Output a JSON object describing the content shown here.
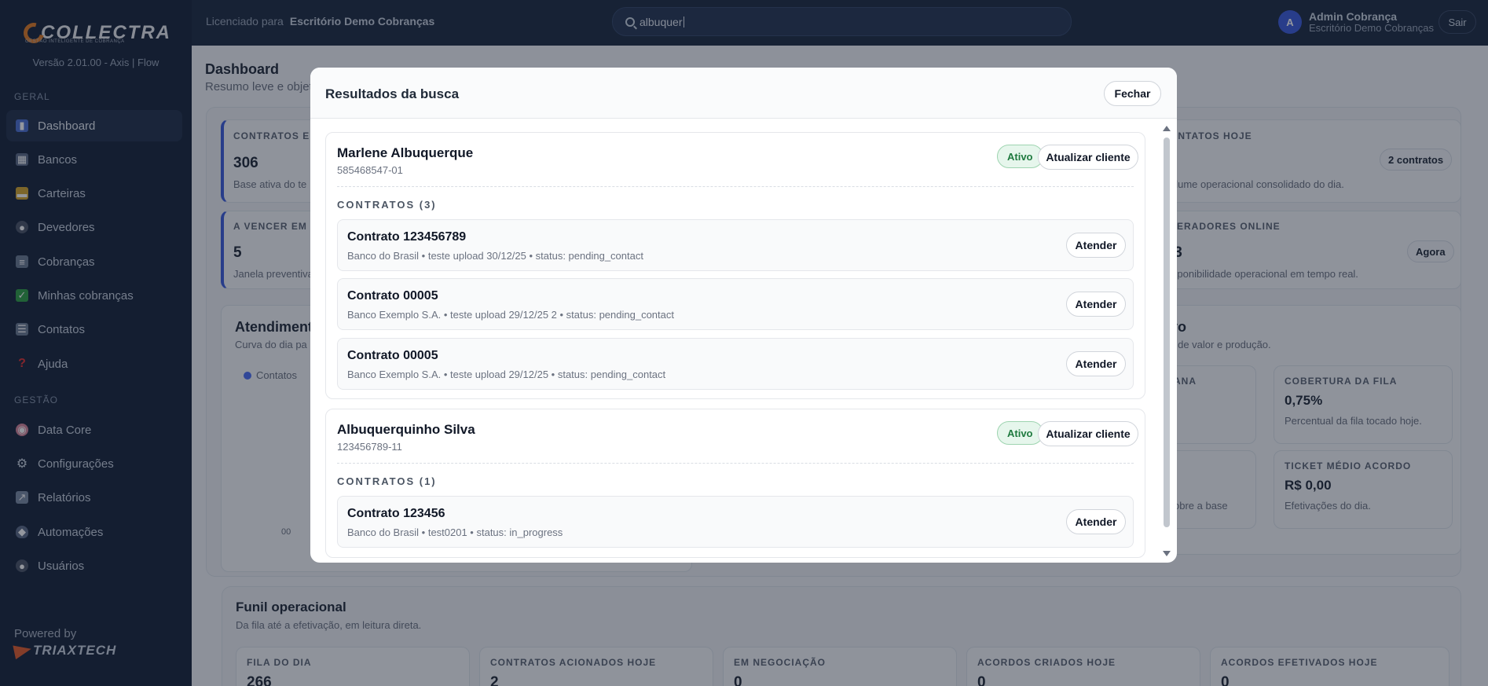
{
  "sidebar": {
    "brand": "COLLECTRA",
    "brand_tagline": "GESTÃO INTELIGENTE DE COBRANÇA",
    "version": "Versão 2.01.00 - Axis | Flow",
    "section_geral": "GERAL",
    "section_gestao": "GESTÃO",
    "items": [
      {
        "label": "Dashboard",
        "icon": "bar-chart-icon"
      },
      {
        "label": "Bancos",
        "icon": "bank-icon"
      },
      {
        "label": "Carteiras",
        "icon": "folder-icon"
      },
      {
        "label": "Devedores",
        "icon": "person-icon"
      },
      {
        "label": "Cobranças",
        "icon": "document-icon"
      },
      {
        "label": "Minhas cobranças",
        "icon": "check-icon"
      },
      {
        "label": "Contatos",
        "icon": "contacts-icon"
      },
      {
        "label": "Ajuda",
        "icon": "question-icon"
      },
      {
        "label": "Data Core",
        "icon": "brain-icon"
      },
      {
        "label": "Configurações",
        "icon": "gear-icon"
      },
      {
        "label": "Relatórios",
        "icon": "report-icon"
      },
      {
        "label": "Automações",
        "icon": "shield-icon"
      },
      {
        "label": "Usuários",
        "icon": "users-icon"
      }
    ],
    "powered_by": "Powered by",
    "powered_brand": "TRIAXTECH"
  },
  "topbar": {
    "license_label": "Licenciado para",
    "license_org": "Escritório Demo Cobranças",
    "search_value": "albuquer",
    "avatar_initial": "A",
    "user_name": "Admin Cobrança",
    "user_org": "Escritório Demo Cobranças",
    "logout_label": "Sair"
  },
  "dashboard": {
    "title": "Dashboard",
    "subtitle": "Resumo leve e objet",
    "kpi_contratos_label": "CONTRATOS E",
    "kpi_contratos_value": "306",
    "kpi_contratos_desc": "Base ativa do te",
    "kpi_vencer_label": "A VENCER EM 7",
    "kpi_vencer_value": "5",
    "kpi_vencer_desc": "Janela preventiva",
    "kpi_contatos_label": "ONTATOS HOJE",
    "kpi_contatos_pill": "2 contratos",
    "kpi_contatos_desc": "olume operacional consolidado do dia.",
    "kpi_operadores_label": "PERADORES ONLINE",
    "kpi_operadores_value": "/3",
    "kpi_operadores_pill": "Agora",
    "kpi_operadores_desc": "isponibilidade operacional em tempo real.",
    "atend_title": "Atendiment",
    "atend_sub": "Curva do dia pa",
    "atend_legend": "Contatos",
    "atend_tick": "00",
    "exec_title": "vo",
    "exec_sub": "s de valor e produção.",
    "semana_label": "ANA",
    "cobertura_label": "COBERTURA DA FILA",
    "cobertura_value": "0,75%",
    "cobertura_desc": "Percentual da fila tocado hoje.",
    "base_desc": "obre a base",
    "ticket_label": "TICKET MÉDIO ACORDO",
    "ticket_value": "R$ 0,00",
    "ticket_desc": "Efetivações do dia.",
    "funil_title": "Funil operacional",
    "funil_sub": "Da fila até a efetivação, em leitura direta.",
    "funil": [
      {
        "label": "FILA DO DIA",
        "value": "266"
      },
      {
        "label": "CONTRATOS ACIONADOS HOJE",
        "value": "2"
      },
      {
        "label": "EM NEGOCIAÇÃO",
        "value": "0"
      },
      {
        "label": "ACORDOS CRIADOS HOJE",
        "value": "0"
      },
      {
        "label": "ACORDOS EFETIVADOS HOJE",
        "value": "0"
      }
    ]
  },
  "modal": {
    "title": "Resultados da busca",
    "close_label": "Fechar",
    "update_label": "Atualizar cliente",
    "attend_label": "Atender",
    "clients": [
      {
        "name": "Marlene Albuquerque",
        "doc": "585468547-01",
        "status": "Ativo",
        "contracts_label": "CONTRATOS (3)",
        "contracts": [
          {
            "title": "Contrato 123456789",
            "meta": "Banco do Brasil • teste upload 30/12/25 • status: pending_contact"
          },
          {
            "title": "Contrato 00005",
            "meta": "Banco Exemplo S.A. • teste upload 29/12/25 2 • status: pending_contact"
          },
          {
            "title": "Contrato 00005",
            "meta": "Banco Exemplo S.A. • teste upload 29/12/25 • status: pending_contact"
          }
        ]
      },
      {
        "name": "Albuquerquinho Silva",
        "doc": "123456789-11",
        "status": "Ativo",
        "contracts_label": "CONTRATOS (1)",
        "contracts": [
          {
            "title": "Contrato 123456",
            "meta": "Banco do Brasil • test0201 • status: in_progress"
          }
        ]
      }
    ]
  },
  "colors": {
    "sidebar_bg": "#16233a",
    "topbar_bg": "#1d2a40",
    "accent": "#3b5bdb",
    "brand_orange": "#e07a22",
    "active_badge": "#1f7a3f"
  }
}
